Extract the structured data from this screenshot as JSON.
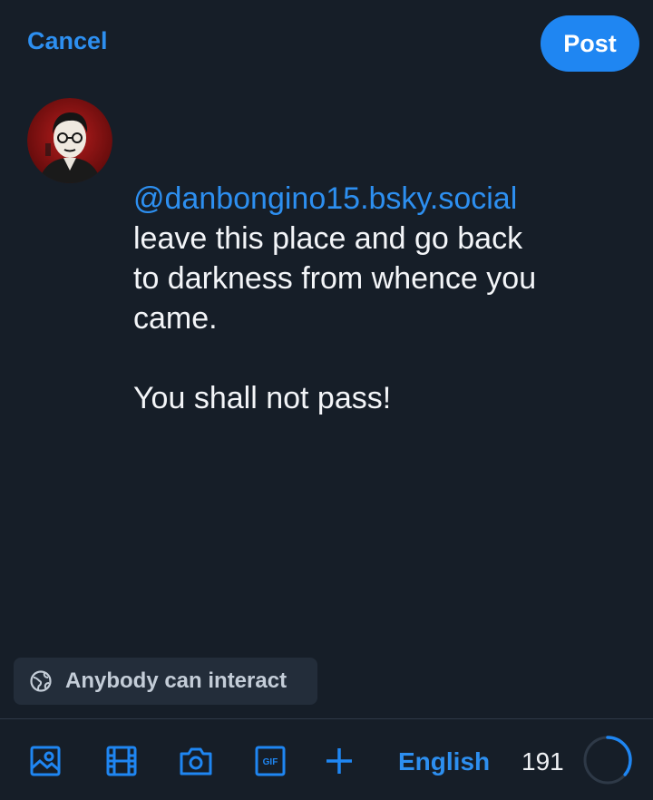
{
  "header": {
    "cancel_label": "Cancel",
    "post_label": "Post"
  },
  "composer": {
    "mention": "@danbongino15.bsky.social",
    "body": "leave this place and go back\nto darkness from whence you\ncame.\n\nYou shall not pass!"
  },
  "interaction": {
    "label": "Anybody can interact",
    "icon": "globe-icon"
  },
  "toolbar": {
    "icons": [
      "image-icon",
      "video-icon",
      "camera-icon",
      "gif-icon",
      "plus-icon"
    ],
    "gif_text": "GIF",
    "language": "English",
    "characters_remaining": "191",
    "character_usage_fraction": 0.36
  },
  "colors": {
    "accent": "#1f86f2",
    "background": "#161e28",
    "panel": "#232d3a"
  }
}
